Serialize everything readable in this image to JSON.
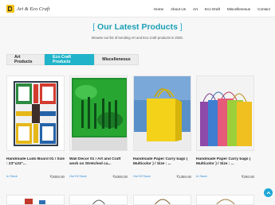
{
  "brand": {
    "name": "Art & Eco Craft"
  },
  "nav": [
    "Home",
    "About Us",
    "Art",
    "Eco Draft",
    "Miscelleneous",
    "Contact"
  ],
  "section": {
    "heading_open": "[",
    "heading": "Our Latest Products",
    "heading_close": "]",
    "subtitle": "Browse our list of trending Art and Eco Craft products in 2026."
  },
  "tabs": [
    {
      "label": "Art Products",
      "active": false
    },
    {
      "label": "Eco Craft Products",
      "active": true
    },
    {
      "label": "Miscelleneous",
      "active": false
    }
  ],
  "products": [
    {
      "title": "Handmade Ludo Board 01 / Size : 23\"x23\"...",
      "status": "In Stock",
      "price": "₹3000.00",
      "image": "ludo-board"
    },
    {
      "title": "Wall Decor 01 / Art and Craft work on Stretched ca...",
      "status": "Out Of Stock",
      "price": "₹4000.00",
      "image": "wall-decor-canvas"
    },
    {
      "title": "Handmade Paper Carry bags ( Multicolor ) / Size : ...",
      "status": "Out Of Stock",
      "price": "₹1350.00",
      "image": "yellow-paper-bag"
    },
    {
      "title": "Handmade Paper Carry bags ( Multicolor ) / Size : ...",
      "status": "In Stock",
      "price": "₹280.00",
      "image": "multicolor-paper-bags"
    }
  ],
  "colors": {
    "accent": "#20b3c9",
    "status": "#2a8ad6"
  },
  "icons": {
    "scroll_top": "arrow-up-icon",
    "logo": "brand-logo-icon"
  }
}
